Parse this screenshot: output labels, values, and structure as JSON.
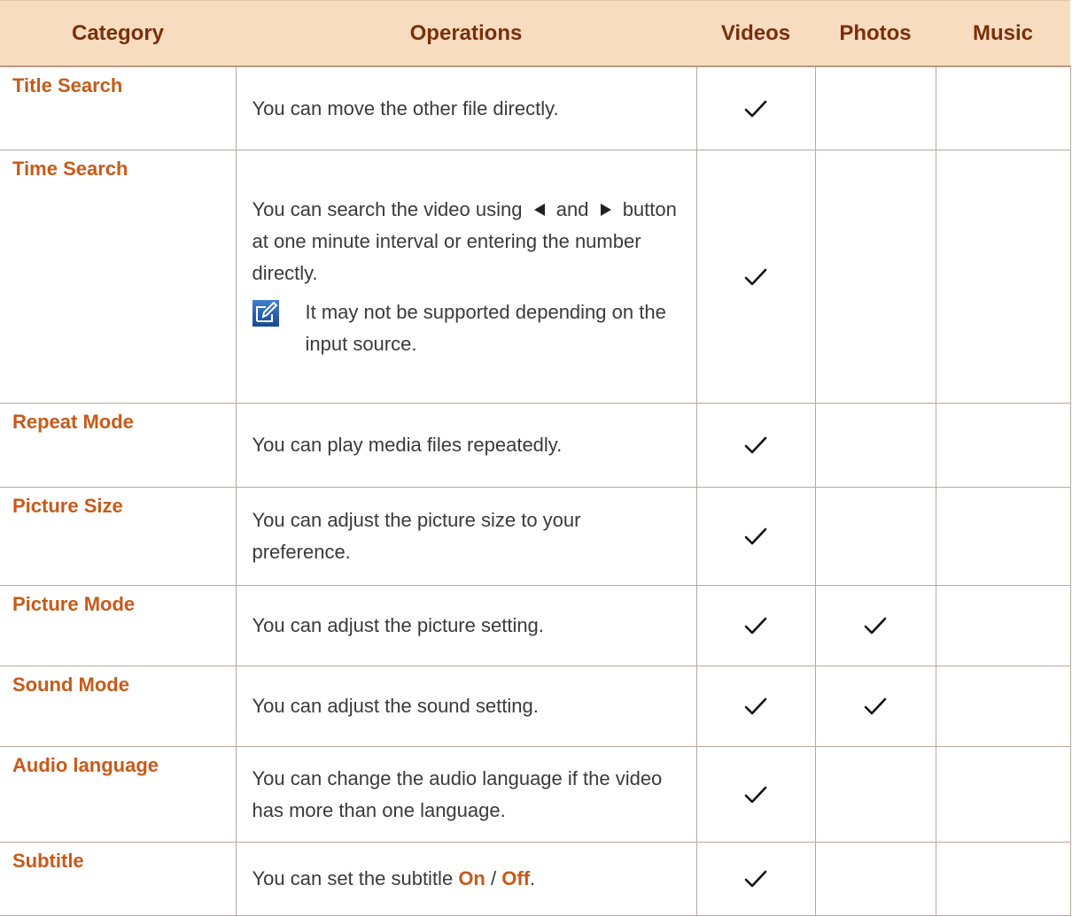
{
  "columns": {
    "category": "Category",
    "operations": "Operations",
    "videos": "Videos",
    "photos": "Photos",
    "music": "Music"
  },
  "colors": {
    "header_bg": "#f8dcc0",
    "header_text": "#7a2f0c",
    "accent": "#c85a19",
    "body_text": "#3a3a3a",
    "grid": "#b9a99b",
    "note_icon_bg": "#1f5aa8"
  },
  "rows": [
    {
      "category": "Title Search",
      "operation": "You can move the other file directly.",
      "videos": true,
      "photos": false,
      "music": false
    },
    {
      "category": "Time Search",
      "operation_part1": "You can search the video using",
      "operation_and": "and",
      "operation_part2": "button at one minute interval or entering the number directly.",
      "left_arrow_icon": "left-triangle-icon",
      "right_arrow_icon": "right-triangle-icon",
      "note_icon": "note-pen-icon",
      "note": "It may not be supported depending on the input source.",
      "videos": true,
      "photos": false,
      "music": false
    },
    {
      "category": "Repeat Mode",
      "operation": "You can play media files repeatedly.",
      "videos": true,
      "photos": false,
      "music": false
    },
    {
      "category": "Picture Size",
      "operation": "You can adjust the picture size to your preference.",
      "videos": true,
      "photos": false,
      "music": false
    },
    {
      "category": "Picture Mode",
      "operation": "You can adjust the picture setting.",
      "videos": true,
      "photos": true,
      "music": false
    },
    {
      "category": "Sound Mode",
      "operation": "You can adjust the sound setting.",
      "videos": true,
      "photos": true,
      "music": false
    },
    {
      "category": "Audio language",
      "operation": "You can change the audio language if the video has more than one language.",
      "videos": true,
      "photos": false,
      "music": false
    },
    {
      "category": "Subtitle",
      "operation_prefix": "You can set the subtitle",
      "operation_on": "On",
      "operation_sep": "/",
      "operation_off": "Off",
      "operation_suffix": ".",
      "videos": true,
      "photos": false,
      "music": false
    }
  ]
}
